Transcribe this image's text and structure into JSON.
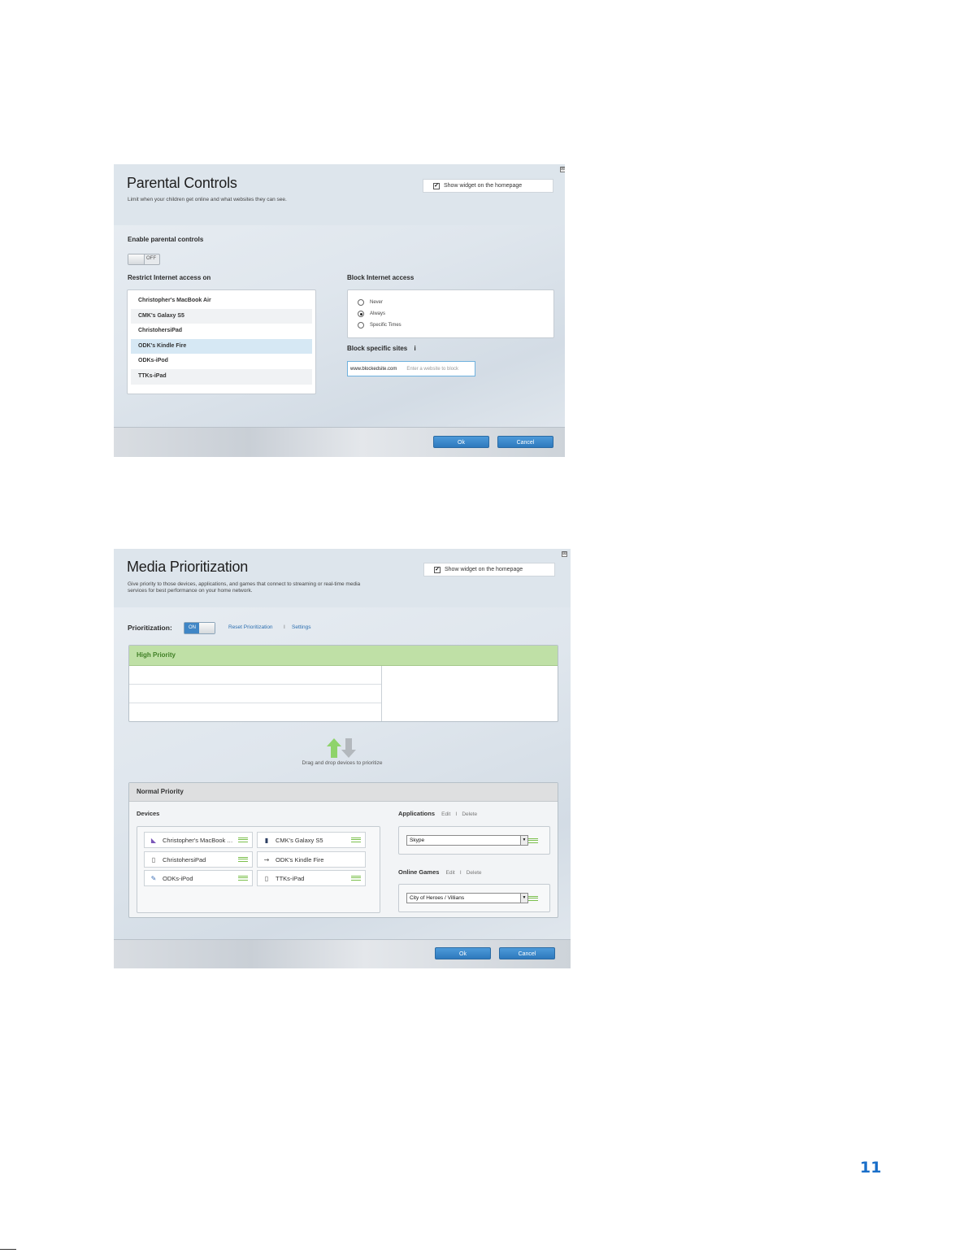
{
  "parental_controls": {
    "title": "Parental Controls",
    "description": "Limit when your children get online and what websites they can see.",
    "widget_checkbox_label": "Show widget on the homepage",
    "widget_checked": true,
    "enable_label": "Enable parental controls",
    "toggle_state": "OFF",
    "restrict_label": "Restrict Internet access on",
    "devices": [
      "Christopher's MacBook Air",
      "CMK's Galaxy S5",
      "ChristohersiPad",
      "ODK's Kindle Fire",
      "ODKs-iPod",
      "TTKs-iPad"
    ],
    "selected_device": "ODK's Kindle Fire",
    "block_label": "Block Internet access",
    "block_options": [
      "Never",
      "Always",
      "Specific Times"
    ],
    "block_selected": "Always",
    "block_sites_label": "Block specific sites",
    "block_sites_info": "i",
    "site_value": "www.blockedsite.com",
    "site_placeholder": "Enter a website to block",
    "ok_label": "Ok",
    "cancel_label": "Cancel",
    "close_glyph": "⊠"
  },
  "media_prioritization": {
    "title": "Media Prioritization",
    "description_line1": "Give priority to those devices, applications, and games that connect to streaming or real-time media",
    "description_line2": "services for best performance on your home network.",
    "widget_checkbox_label": "Show widget on the homepage",
    "widget_checked": true,
    "prioritization_label": "Prioritization:",
    "toggle_state": "ON",
    "reset_link": "Reset Prioritization",
    "separator": "I",
    "settings_link": "Settings",
    "high_priority_label": "High Priority",
    "drag_hint": "Drag and drop devices to prioritize",
    "normal_priority_label": "Normal Priority",
    "devices_label": "Devices",
    "devices": [
      {
        "name": "Christopher's MacBook Air",
        "icon": "laptop-icon",
        "glyph": "◣"
      },
      {
        "name": "CMK's Galaxy S5",
        "icon": "phone-icon",
        "glyph": "▮"
      },
      {
        "name": "ChristohersiPad",
        "icon": "tablet-icon",
        "glyph": "▯"
      },
      {
        "name": "ODK's Kindle Fire",
        "icon": "ereader-icon",
        "glyph": "⇝"
      },
      {
        "name": "ODKs-iPod",
        "icon": "media-player-icon",
        "glyph": "✎"
      },
      {
        "name": "TTKs-iPad",
        "icon": "tablet-icon",
        "glyph": "▯"
      }
    ],
    "applications_label": "Applications",
    "applications_edit": "Edit",
    "applications_delete": "Delete",
    "application_selected": "Skype",
    "games_label": "Online Games",
    "games_edit": "Edit",
    "games_delete": "Delete",
    "game_selected": "City of Heroes / Villians",
    "ok_label": "Ok",
    "cancel_label": "Cancel",
    "close_glyph": "⊠",
    "arrow_up_color": "#8fd36a",
    "arrow_down_color": "#b3b8bd"
  },
  "page_number": "11"
}
